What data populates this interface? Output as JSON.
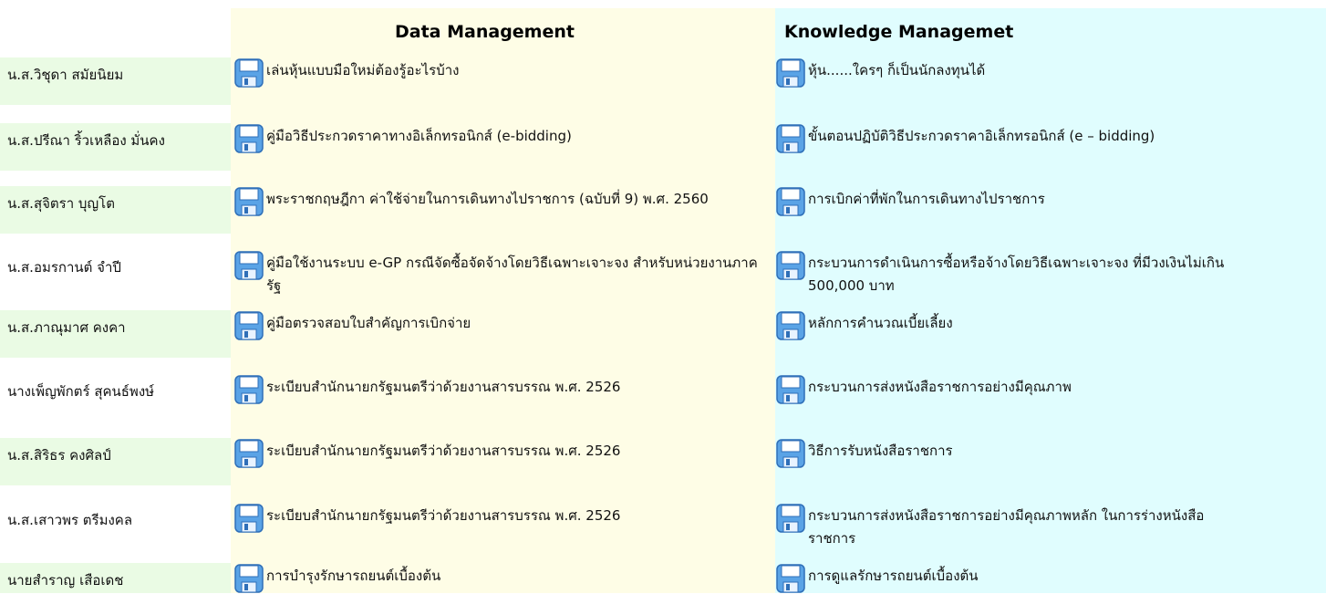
{
  "headers": {
    "data_management": "Data Management",
    "knowledge_management": "Knowledge Managemet"
  },
  "rows": [
    {
      "name": "น.ส.วิชุดา สมัยนิยม",
      "dm": "เล่นหุ้นแบบมือใหม่ต้องรู้อะไรบ้าง",
      "km": "หุ้น......ใครๆ ก็เป็นนักลงทุนได้"
    },
    {
      "name": "น.ส.ปรีณา ริ้วเหลือง มั่นคง",
      "dm": "คู่มือวิธีประกวดราคาทางอิเล็กทรอนิกส์ (e-bidding)",
      "km": "ขั้นตอนปฏิบัติวิธีประกวดราคาอิเล็กทรอนิกส์ (e – bidding)"
    },
    {
      "name": "น.ส.สุจิตรา บุญโต",
      "dm": "พระราชกฤษฎีกา ค่าใช้จ่ายในการเดินทางไปราชการ (ฉบับที่ 9) พ.ศ. 2560",
      "km": "การเบิกค่าที่พักในการเดินทางไปราชการ"
    },
    {
      "name": "น.ส.อมรกานต์ จำปี",
      "dm": "คู่มือใช้งานระบบ e-GP กรณีจัดซื้อจัดจ้างโดยวิธีเฉพาะเจาะจง สำหรับหน่วยงานภาครัฐ",
      "km": "กระบวนการดำเนินการซื้อหรือจ้างโดยวิธีเฉพาะเจาะจง ที่มีวงเงินไม่เกิน 500,000 บาท"
    },
    {
      "name": "น.ส.ภาณุมาศ คงคา",
      "dm": "คู่มือตรวจสอบใบสำคัญการเบิกจ่าย",
      "km": "หลักการคำนวณเบี้ยเลี้ยง"
    },
    {
      "name": "นางเพ็ญพักตร์ สุคนธ์พงษ์",
      "dm": "ระเบียบสำนักนายกรัฐมนตรีว่าด้วยงานสารบรรณ พ.ศ. 2526",
      "km": "กระบวนการส่งหนังสือราชการอย่างมีคุณภาพ"
    },
    {
      "name": "น.ส.สิริธร คงศิลป์",
      "dm": "ระเบียบสำนักนายกรัฐมนตรีว่าด้วยงานสารบรรณ พ.ศ. 2526",
      "km": "วิธีการรับหนังสือราชการ"
    },
    {
      "name": "น.ส.เสาวพร ตรีมงคล",
      "dm": "ระเบียบสำนักนายกรัฐมนตรีว่าด้วยงานสารบรรณ พ.ศ. 2526",
      "km": "กระบวนการส่งหนังสือราชการอย่างมีคุณภาพหลัก ในการร่างหนังสือราชการ"
    },
    {
      "name": "นายสำราญ เสือเดช",
      "dm": "การบำรุงรักษารถยนต์เบื้องต้น",
      "km": "การดูแลรักษารถยนต์เบื้องต้น"
    }
  ],
  "icons": {
    "save": "floppy-disk-icon",
    "disk_color": "#5aa3e6",
    "disk_dark": "#2f6fb8"
  }
}
